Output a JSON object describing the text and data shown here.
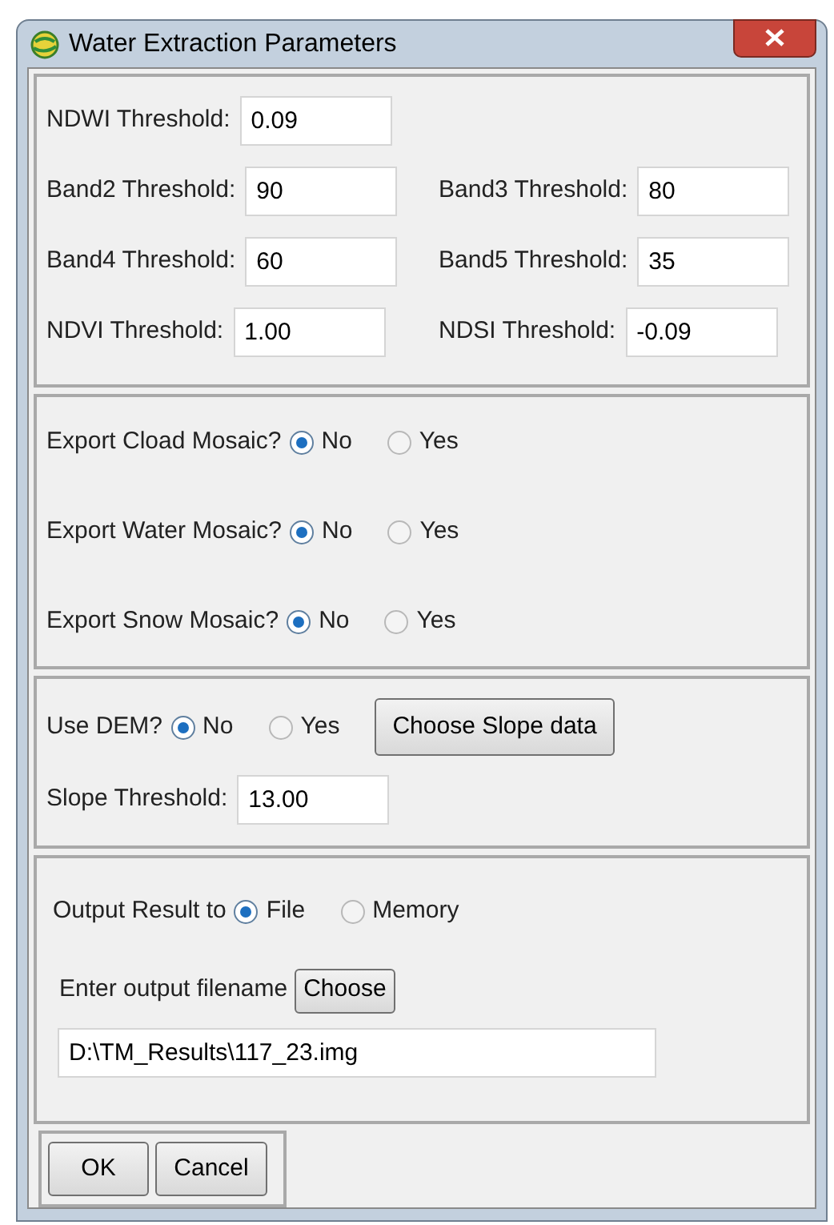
{
  "window": {
    "title": "Water Extraction Parameters"
  },
  "thresholds": [
    [
      {
        "label": "NDWI Threshold:",
        "value": "0.09"
      }
    ],
    [
      {
        "label": "Band2 Threshold:",
        "value": "90"
      },
      {
        "label": "Band3 Threshold:",
        "value": "80"
      }
    ],
    [
      {
        "label": "Band4 Threshold:",
        "value": "60"
      },
      {
        "label": "Band5 Threshold:",
        "value": "35"
      }
    ],
    [
      {
        "label": "NDVI Threshold:",
        "value": "1.00"
      },
      {
        "label": "NDSI Threshold:",
        "value": "-0.09"
      }
    ]
  ],
  "exports": [
    {
      "label": "Export Cload Mosaic?",
      "options": [
        {
          "label": "No",
          "selected": true
        },
        {
          "label": "Yes",
          "selected": false
        }
      ]
    },
    {
      "label": "Export Water Mosaic?",
      "options": [
        {
          "label": "No",
          "selected": true
        },
        {
          "label": "Yes",
          "selected": false
        }
      ]
    },
    {
      "label": "Export Snow Mosaic?",
      "options": [
        {
          "label": "No",
          "selected": true
        },
        {
          "label": "Yes",
          "selected": false
        }
      ]
    }
  ],
  "dem": {
    "label": "Use DEM?",
    "options": [
      {
        "label": "No",
        "selected": true
      },
      {
        "label": "Yes",
        "selected": false
      }
    ],
    "button": "Choose Slope data",
    "slope_label": "Slope Threshold:",
    "slope_value": "13.00"
  },
  "output": {
    "label": "Output Result to",
    "options": [
      {
        "label": "File",
        "selected": true
      },
      {
        "label": "Memory",
        "selected": false
      }
    ],
    "filename_label": "Enter output filename",
    "choose_button": "Choose",
    "filename": "D:\\TM_Results\\117_23.img"
  },
  "buttons": [
    "OK",
    "Cancel"
  ]
}
